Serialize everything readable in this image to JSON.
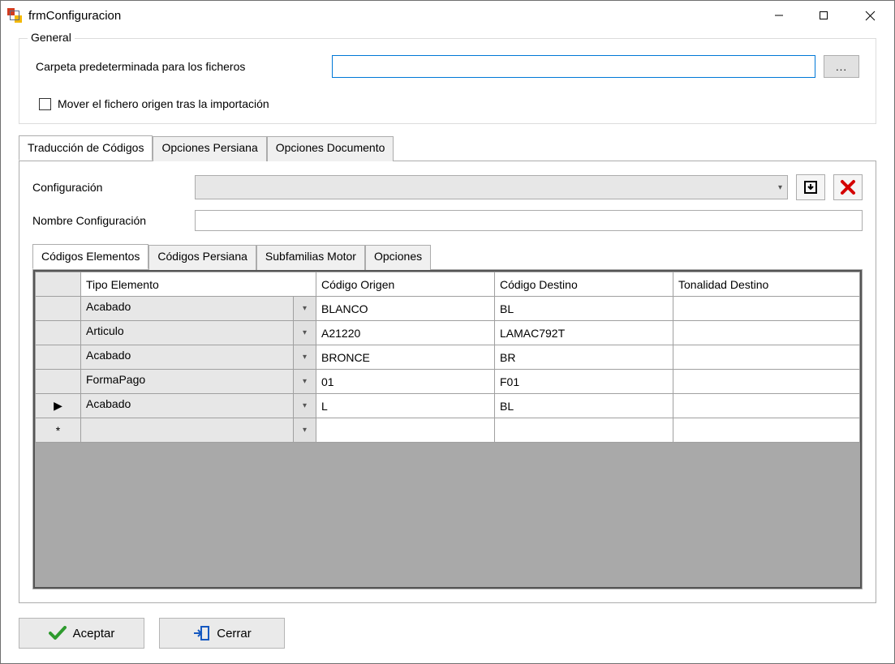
{
  "window": {
    "title": "frmConfiguracion"
  },
  "general": {
    "legend": "General",
    "folder_label": "Carpeta predeterminada para los ficheros",
    "folder_value": "",
    "browse_label": "...",
    "move_checkbox_label": "Mover el fichero origen tras la importación",
    "move_checked": false
  },
  "outer_tabs": {
    "tab1": "Traducción de Códigos",
    "tab2": "Opciones Persiana",
    "tab3": "Opciones Documento",
    "active": 0
  },
  "config": {
    "combo_label": "Configuración",
    "combo_value": "",
    "name_label": "Nombre Configuración",
    "name_value": ""
  },
  "inner_tabs": {
    "tab1": "Códigos Elementos",
    "tab2": "Códigos Persiana",
    "tab3": "Subfamilias Motor",
    "tab4": "Opciones",
    "active": 0
  },
  "grid": {
    "col_tipo": "Tipo Elemento",
    "col_origen": "Código Origen",
    "col_destino": "Código Destino",
    "col_tonalidad": "Tonalidad Destino",
    "rows": {
      "0": {
        "tipo": "Acabado",
        "origen": "BLANCO",
        "destino": "BL",
        "tonalidad": ""
      },
      "1": {
        "tipo": "Articulo",
        "origen": "A21220",
        "destino": "LAMAC792T",
        "tonalidad": ""
      },
      "2": {
        "tipo": "Acabado",
        "origen": "BRONCE",
        "destino": "BR",
        "tonalidad": ""
      },
      "3": {
        "tipo": "FormaPago",
        "origen": "01",
        "destino": "F01",
        "tonalidad": ""
      },
      "4": {
        "tipo": "Acabado",
        "origen": "L",
        "destino": "BL",
        "tonalidad": ""
      }
    },
    "current_row_marker": "▶",
    "new_row_marker": "*"
  },
  "buttons": {
    "accept": "Aceptar",
    "close": "Cerrar"
  },
  "icons": {
    "save": "save-icon",
    "delete": "delete-icon",
    "check": "check-icon",
    "enter": "enter-icon"
  }
}
